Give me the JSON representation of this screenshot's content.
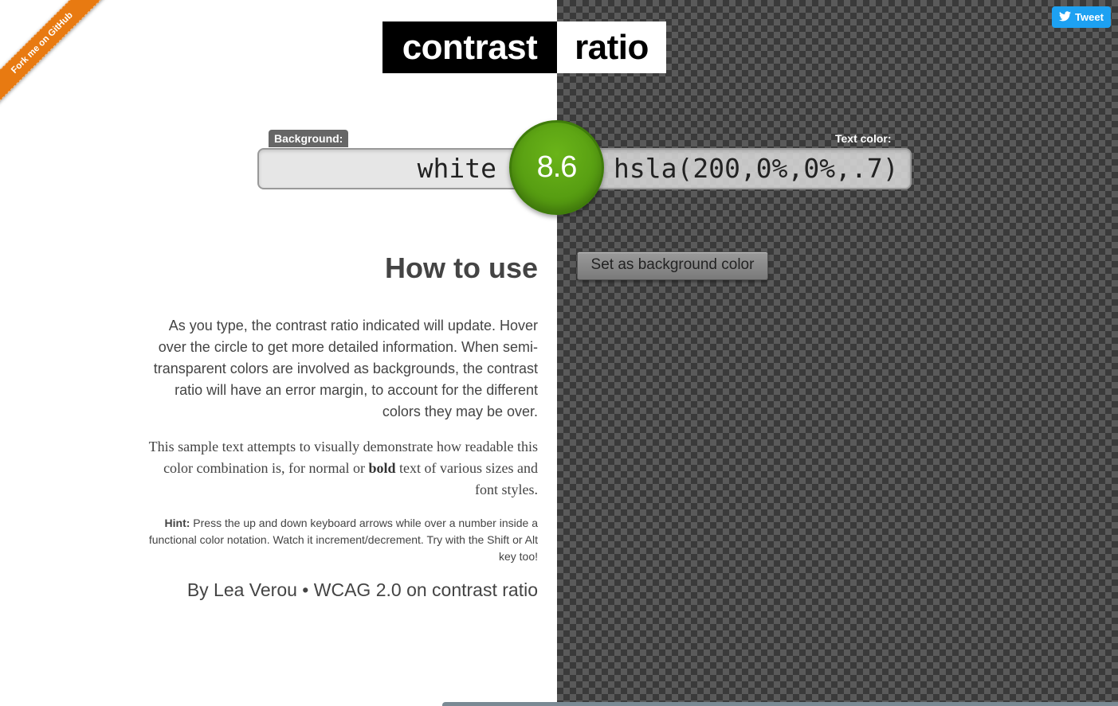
{
  "ribbon": {
    "label": "Fork me on GitHub"
  },
  "tweet": {
    "label": "Tweet"
  },
  "title": {
    "dark": "contrast",
    "light": "ratio"
  },
  "background": {
    "label": "Background:",
    "value": "white"
  },
  "text_color": {
    "label": "Text color:",
    "value": "hsla(200,0%,0%,.7)"
  },
  "ratio": {
    "value": "8.6"
  },
  "swap_button": {
    "label": "Set as background color"
  },
  "howto": {
    "heading": "How to use",
    "para1": "As you type, the contrast ratio indicated will update. Hover over the circle to get more detailed information. When semi-transparent colors are involved as backgrounds, the contrast ratio will have an error margin, to account for the different colors they may be over.",
    "para2_before": "This sample text attempts to visually demonstrate how readable this color combination is, for normal or ",
    "para2_bold": "bold",
    "para2_after": " text of various sizes and font styles.",
    "hint_label": "Hint:",
    "hint_text": " Press the up and down keyboard arrows while over a number inside a functional color notation. Watch it increment/decrement. Try with the Shift or Alt key too!",
    "byline_author": "By Lea Verou",
    "byline_sep": " • ",
    "byline_link": "WCAG 2.0 on contrast ratio"
  },
  "colors": {
    "ratio_green": "#5a9e14",
    "ribbon_orange": "#e87a11",
    "tweet_blue": "#1da1f2"
  }
}
